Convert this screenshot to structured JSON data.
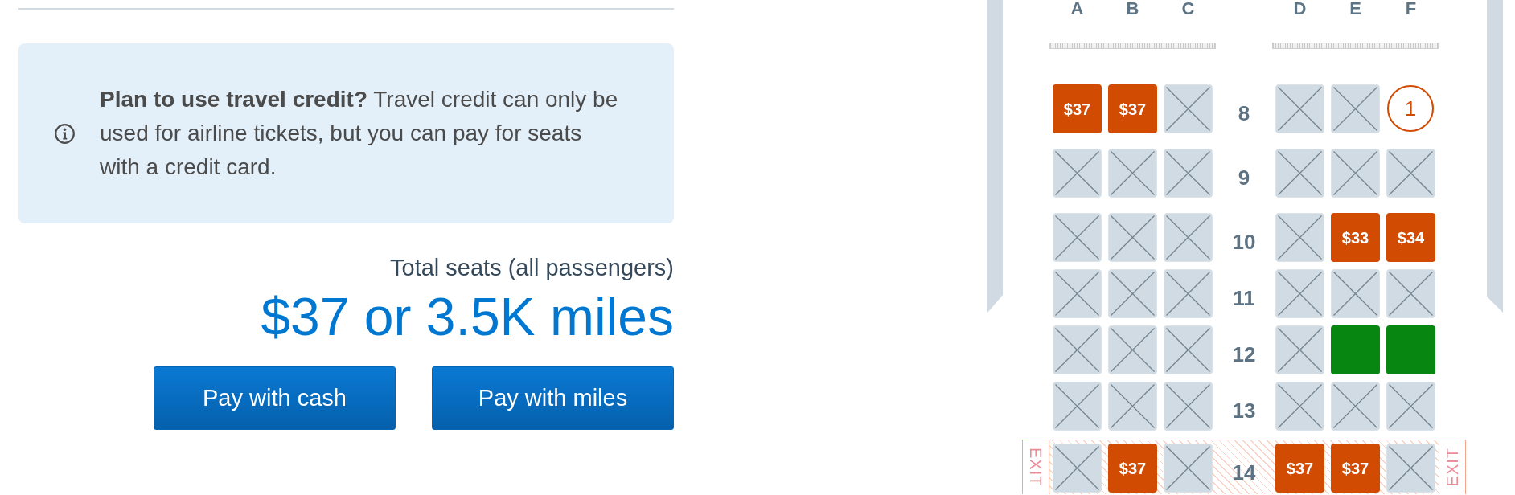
{
  "info_banner": {
    "text": "**Plan to use travel credit?** Travel credit can only be used for airline tickets, but you can pay for seats with a credit card."
  },
  "total": {
    "label": "Total seats (all passengers)",
    "amount": "$37 or 3.5K miles"
  },
  "buttons": [
    "Pay with cash",
    "Pay with miles"
  ],
  "seat_map": {
    "columns": [
      "A",
      "B",
      "C",
      "D",
      "E",
      "F"
    ],
    "rows": [
      {
        "number": "8",
        "exit": false,
        "seats": [
          {
            "kind": "paid",
            "price": "$37"
          },
          {
            "kind": "paid",
            "price": "$37"
          },
          {
            "kind": "occupied"
          },
          {
            "kind": "occupied"
          },
          {
            "kind": "occupied"
          },
          {
            "kind": "assigned",
            "passenger": "1"
          }
        ]
      },
      {
        "number": "9",
        "exit": false,
        "seats": [
          {
            "kind": "occupied"
          },
          {
            "kind": "occupied"
          },
          {
            "kind": "occupied"
          },
          {
            "kind": "occupied"
          },
          {
            "kind": "occupied"
          },
          {
            "kind": "occupied"
          }
        ]
      },
      {
        "number": "10",
        "exit": false,
        "seats": [
          {
            "kind": "occupied"
          },
          {
            "kind": "occupied"
          },
          {
            "kind": "occupied"
          },
          {
            "kind": "occupied"
          },
          {
            "kind": "paid",
            "price": "$33"
          },
          {
            "kind": "paid",
            "price": "$34"
          }
        ]
      },
      {
        "number": "11",
        "exit": false,
        "seats": [
          {
            "kind": "occupied"
          },
          {
            "kind": "occupied"
          },
          {
            "kind": "occupied"
          },
          {
            "kind": "occupied"
          },
          {
            "kind": "occupied"
          },
          {
            "kind": "occupied"
          }
        ]
      },
      {
        "number": "12",
        "exit": false,
        "seats": [
          {
            "kind": "occupied"
          },
          {
            "kind": "occupied"
          },
          {
            "kind": "occupied"
          },
          {
            "kind": "occupied"
          },
          {
            "kind": "open"
          },
          {
            "kind": "open"
          }
        ]
      },
      {
        "number": "13",
        "exit": false,
        "seats": [
          {
            "kind": "occupied"
          },
          {
            "kind": "occupied"
          },
          {
            "kind": "occupied"
          },
          {
            "kind": "occupied"
          },
          {
            "kind": "occupied"
          },
          {
            "kind": "occupied"
          }
        ]
      },
      {
        "number": "14",
        "exit": true,
        "exit_labels": [
          "EXIT",
          "EXIT"
        ],
        "seats": [
          {
            "kind": "occupied"
          },
          {
            "kind": "paid",
            "price": "$37"
          },
          {
            "kind": "occupied"
          },
          {
            "kind": "paid",
            "price": "$37"
          },
          {
            "kind": "paid",
            "price": "$37"
          },
          {
            "kind": "occupied"
          }
        ]
      }
    ]
  }
}
